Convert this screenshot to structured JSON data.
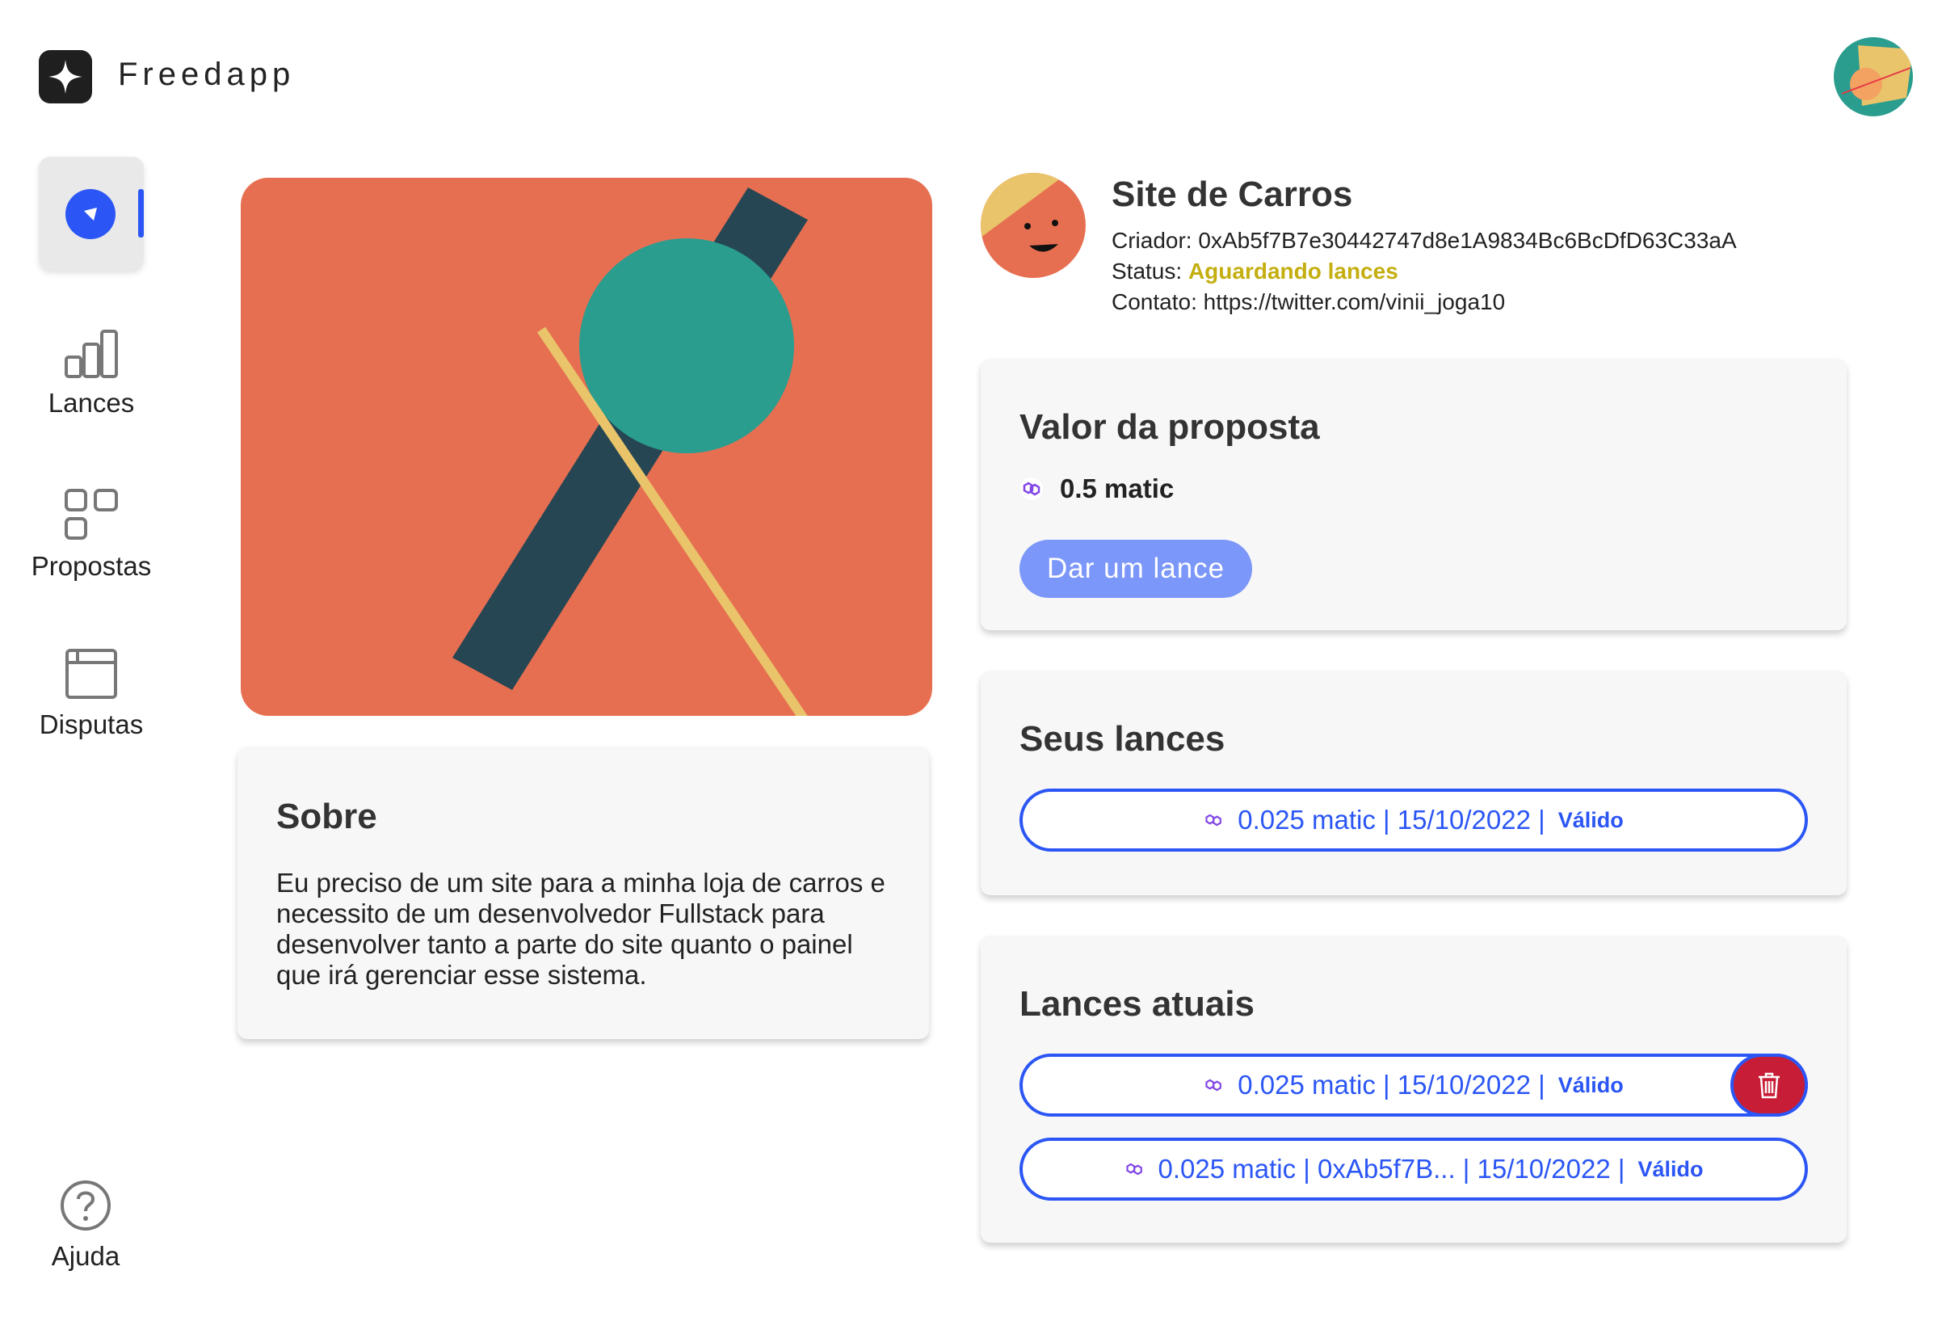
{
  "header": {
    "brand": "Freedapp",
    "logo_icon": "sparkle-icon",
    "user_avatar_icon": "abstract-avatar"
  },
  "sidebar": {
    "items": [
      {
        "label": "",
        "icon": "compass-icon",
        "active": true
      },
      {
        "label": "Lances",
        "icon": "bar-chart-icon"
      },
      {
        "label": "Propostas",
        "icon": "grid-icon"
      },
      {
        "label": "Disputas",
        "icon": "window-icon"
      }
    ],
    "help": {
      "label": "Ajuda",
      "icon": "question-circle-icon"
    }
  },
  "project": {
    "title": "Site de Carros",
    "creator_label": "Criador: ",
    "creator": "0xAb5f7B7e30442747d8e1A9834Bc6BcDfD63C33aA",
    "status_label": "Status: ",
    "status": "Aguardando lances",
    "contact_label": "Contato: ",
    "contact": "https://twitter.com/vinii_joga10"
  },
  "about": {
    "title": "Sobre",
    "text": "Eu preciso de um site para a minha loja de carros e necessito de um desenvolvedor Fullstack para desenvolver tanto a parte do site quanto o painel que irá gerenciar esse sistema."
  },
  "proposal": {
    "title": "Valor da proposta",
    "value": "0.5 matic",
    "button": "Dar um lance"
  },
  "my_bids": {
    "title": "Seus lances",
    "items": [
      {
        "text": "0.025 matic | 15/10/2022 |",
        "status": "Válido"
      }
    ]
  },
  "current_bids": {
    "title": "Lances atuais",
    "items": [
      {
        "text": "0.025 matic | 15/10/2022 |",
        "status": "Válido",
        "deletable": true
      },
      {
        "text": "0.025 matic | 0xAb5f7B... | 15/10/2022 |",
        "status": "Válido"
      }
    ]
  },
  "colors": {
    "accent": "#2b56f5",
    "hero_bg": "#e76f51",
    "status": "#c4ae10",
    "delete": "#c81d36"
  }
}
